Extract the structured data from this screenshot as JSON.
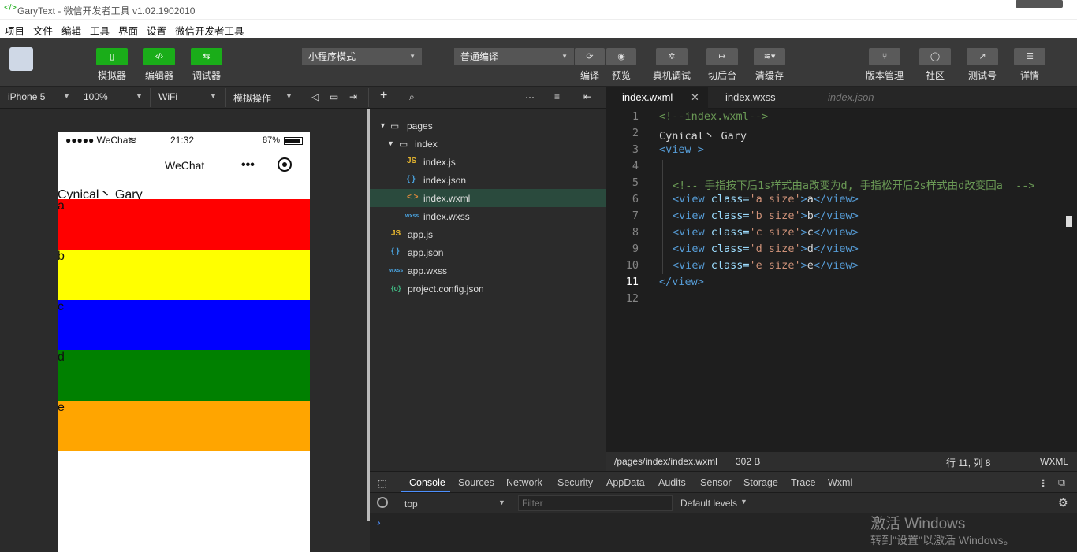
{
  "window": {
    "title": "GaryText - 微信开发者工具 v1.02.1902010"
  },
  "menu": [
    "项目",
    "文件",
    "编辑",
    "工具",
    "界面",
    "设置",
    "微信开发者工具"
  ],
  "toolbar": {
    "left_buttons": [
      {
        "label": "模拟器",
        "icon": "phone-icon"
      },
      {
        "label": "编辑器",
        "icon": "code-icon"
      },
      {
        "label": "调试器",
        "icon": "debug-icon"
      }
    ],
    "mode_select": "小程序模式",
    "compile_select": "普通编译",
    "mid_buttons": [
      {
        "label": "编译",
        "icon": "refresh-icon"
      },
      {
        "label": "预览",
        "icon": "eye-icon"
      },
      {
        "label": "真机调试",
        "icon": "bug-icon"
      },
      {
        "label": "切后台",
        "icon": "switch-icon"
      },
      {
        "label": "清缓存",
        "icon": "layers-icon"
      }
    ],
    "right_buttons": [
      {
        "label": "版本管理",
        "icon": "branch-icon"
      },
      {
        "label": "社区",
        "icon": "chat-icon"
      },
      {
        "label": "测试号",
        "icon": "external-icon"
      },
      {
        "label": "详情",
        "icon": "menu-icon"
      }
    ]
  },
  "simbar": {
    "device": "iPhone 5",
    "zoom": "100%",
    "network": "WiFi",
    "ops": "模拟操作"
  },
  "phone": {
    "carrier": "●●●●● WeChat",
    "time": "21:32",
    "battery": "87%",
    "nav_title": "WeChat",
    "page_title": "Cynical丶 Gary",
    "blocks": [
      {
        "label": "a",
        "color": "#ff0000"
      },
      {
        "label": "b",
        "color": "#ffff00"
      },
      {
        "label": "c",
        "color": "#0000ff"
      },
      {
        "label": "d",
        "color": "#008000"
      },
      {
        "label": "e",
        "color": "#ffa500"
      }
    ]
  },
  "tree": {
    "pages": "pages",
    "index_folder": "index",
    "files": [
      {
        "name": "index.js",
        "icon_text": "JS"
      },
      {
        "name": "index.json",
        "icon_text": "{ }"
      },
      {
        "name": "index.wxml",
        "icon_text": "< >"
      },
      {
        "name": "index.wxss",
        "icon_text": "wxss"
      },
      {
        "name": "app.js",
        "icon_text": "JS"
      },
      {
        "name": "app.json",
        "icon_text": "{ }"
      },
      {
        "name": "app.wxss",
        "icon_text": "wxss"
      },
      {
        "name": "project.config.json",
        "icon_text": "{o}"
      }
    ]
  },
  "tabs": [
    "index.wxml",
    "index.wxss",
    "index.json"
  ],
  "code": {
    "line_numbers": [
      "1",
      "2",
      "3",
      "4",
      "5",
      "6",
      "7",
      "8",
      "9",
      "10",
      "11",
      "12"
    ],
    "l1": "<!--index.wxml-->",
    "l2": "Cynical丶 Gary",
    "l3_tag": "<view",
    "l3_end": " >",
    "l5": "<!-- 手指按下后1s样式由a改变为d, 手指松开后2s样式由d改变回a  -->",
    "views": [
      {
        "cls": "'a size'",
        "txt": "a"
      },
      {
        "cls": "'b size'",
        "txt": "b"
      },
      {
        "cls": "'c size'",
        "txt": "c"
      },
      {
        "cls": "'d size'",
        "txt": "d"
      },
      {
        "cls": "'e size'",
        "txt": "e"
      }
    ],
    "open_view": "<view",
    "class_attr": " class=",
    "gt": ">",
    "close_view": "</view>",
    "l11": "</view>"
  },
  "status": {
    "path": "/pages/index/index.wxml",
    "size": "302 B",
    "pos": "行 11, 列 8",
    "lang": "WXML"
  },
  "devtools": {
    "tabs": [
      "Console",
      "Sources",
      "Network",
      "Security",
      "AppData",
      "Audits",
      "Sensor",
      "Storage",
      "Trace",
      "Wxml"
    ],
    "context": "top",
    "filter_placeholder": "Filter",
    "levels": "Default levels",
    "prompt": "›"
  },
  "watermark": {
    "line1": "激活 Windows",
    "line2": "转到\"设置\"以激活 Windows。"
  }
}
